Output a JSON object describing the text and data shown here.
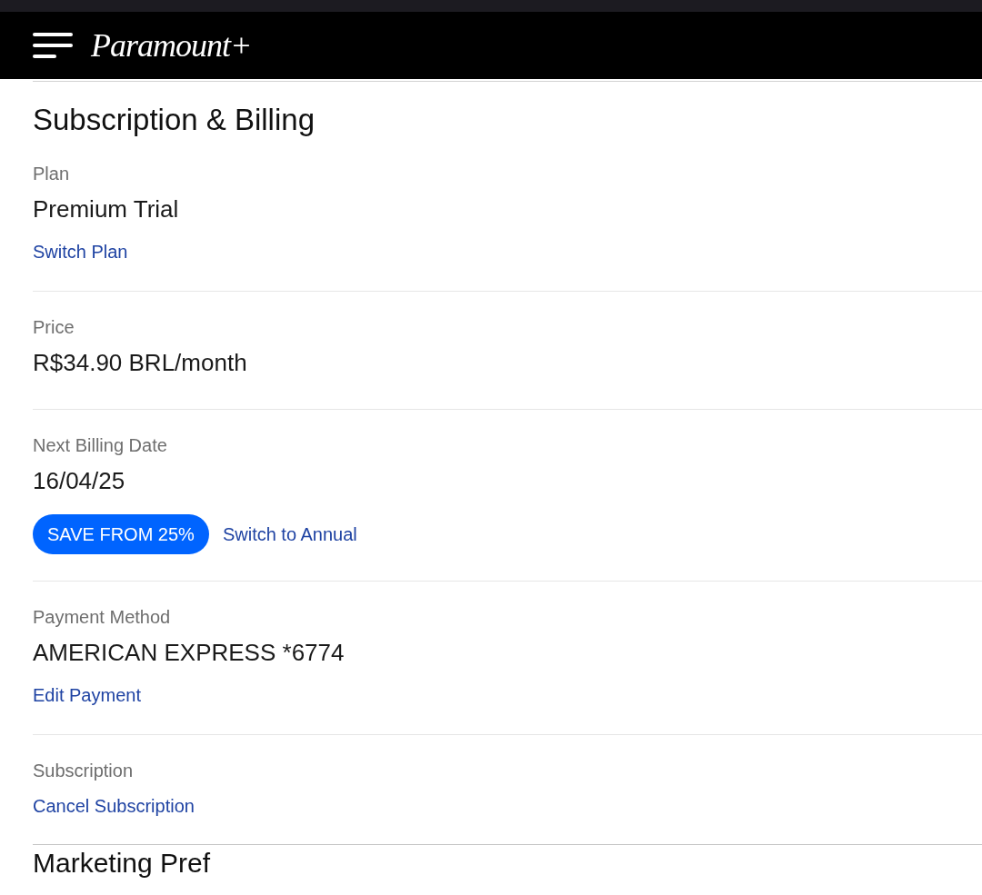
{
  "header": {
    "logo": "Paramount+"
  },
  "page_title": "Subscription & Billing",
  "sections": [
    {
      "label": "Plan",
      "value": "Premium Trial",
      "actions": [
        {
          "kind": "link",
          "text": "Switch Plan"
        }
      ]
    },
    {
      "label": "Price",
      "value": "R$34.90 BRL/month"
    },
    {
      "label": "Next Billing Date",
      "value": "16/04/25",
      "actions": [
        {
          "kind": "badge",
          "text": "SAVE FROM 25%"
        },
        {
          "kind": "link",
          "text": "Switch to Annual"
        }
      ]
    },
    {
      "label": "Payment Method",
      "value": "AMERICAN EXPRESS *6774",
      "actions": [
        {
          "kind": "link",
          "text": "Edit Payment"
        }
      ]
    },
    {
      "label": "Subscription",
      "actions": [
        {
          "kind": "link",
          "text": "Cancel Subscription"
        }
      ]
    }
  ],
  "next_heading": "Marketing Pref"
}
